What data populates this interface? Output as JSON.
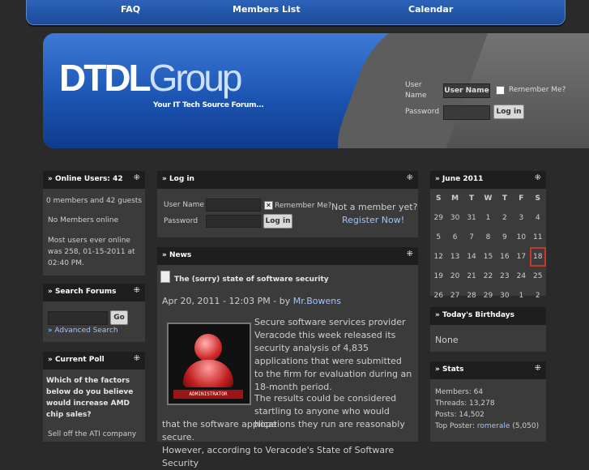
{
  "nav": {
    "faq": "FAQ",
    "members": "Members List",
    "calendar": "Calendar"
  },
  "header": {
    "logo_dtdl": "DTDL",
    "logo_group": "Group",
    "tagline": "Your IT Tech Source Forum...",
    "user_name_label": "User Name",
    "username_value": "User Name",
    "remember_label": "Remember Me?",
    "password_label": "Password",
    "login_button": "Log in"
  },
  "online": {
    "title": "» Online Users: 42",
    "line1": "0 members and 42 guests",
    "line2": "No Members online",
    "line3": "Most users ever online was 258, 01-15-2011 at 02:40 PM."
  },
  "search": {
    "title": "» Search Forums",
    "go": "Go",
    "advanced": "» Advanced Search"
  },
  "poll": {
    "title": "» Current Poll",
    "question": "Which of the factors below do you believe would increase AMD chip sales?",
    "option1": "Sell off the ATI company"
  },
  "login": {
    "title": "» Log in",
    "user_label": "User Name",
    "remember": "Remember Me?",
    "pass_label": "Password",
    "button": "Log in",
    "not_member": "Not a member yet?",
    "register": "Register Now!"
  },
  "news": {
    "title": "» News",
    "headline": "The (sorry) state of software security",
    "date": "Apr 20, 2011 - 12:03 PM - by",
    "author": "Mr.Bowens",
    "badge": "ADMINISTRATOR",
    "para1": "Secure software services provider Veracode this week released its security analysis of 4,835 applications that were submitted to the firm for evaluation during an 18-month period.",
    "para2a": "The results could be considered startling to anyone who would hope",
    "para2b": "that the software applications they run are reasonably secure.",
    "para2c": "However, according to Veracode's State of Software Security"
  },
  "calendar": {
    "title": "» June 2011",
    "days": [
      "S",
      "M",
      "T",
      "W",
      "T",
      "F",
      "S"
    ],
    "weeks": [
      [
        "29",
        "30",
        "31",
        "1",
        "2",
        "3",
        "4"
      ],
      [
        "5",
        "6",
        "7",
        "8",
        "9",
        "10",
        "11"
      ],
      [
        "12",
        "13",
        "14",
        "15",
        "16",
        "17",
        "18"
      ],
      [
        "19",
        "20",
        "21",
        "22",
        "23",
        "24",
        "25"
      ],
      [
        "26",
        "27",
        "28",
        "29",
        "30",
        "1",
        "2"
      ]
    ],
    "today": "18"
  },
  "birthdays": {
    "title": "» Today's Birthdays",
    "none": "None"
  },
  "stats": {
    "title": "» Stats",
    "members": "Members: 64",
    "threads": "Threads: 13,278",
    "posts": "Posts: 14,502",
    "top_label": "Top Poster:",
    "top_name": "romerale",
    "top_count": "(5,050)"
  },
  "colors": {
    "accent": "#1d55b3",
    "link": "#9fc3ff",
    "today_border": "#c0392b"
  }
}
